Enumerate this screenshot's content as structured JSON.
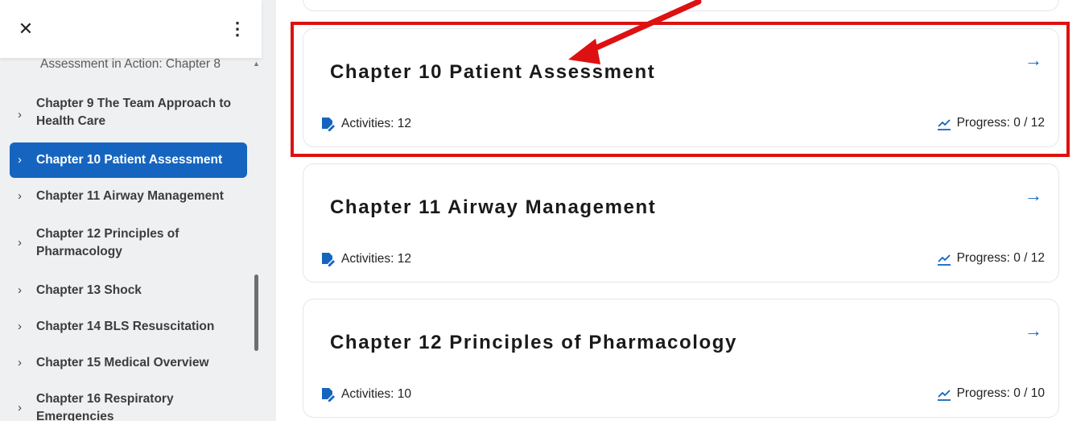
{
  "sidebar": {
    "close_icon": "close-icon",
    "more_icon": "more-vertical-icon",
    "close_glyph": "✕",
    "more_glyph": "⋮",
    "subitem": "Assessment in Action: Chapter 8",
    "items": [
      {
        "label_lines": [
          "Chapter 9 The Team Approach to",
          "Health Care"
        ],
        "active": false
      },
      {
        "label_lines": [
          "Chapter 10 Patient Assessment"
        ],
        "active": true
      },
      {
        "label_lines": [
          "Chapter 11 Airway Management"
        ],
        "active": false
      },
      {
        "label_lines": [
          "Chapter 12 Principles of",
          "Pharmacology"
        ],
        "active": false
      },
      {
        "label_lines": [
          "Chapter 13 Shock"
        ],
        "active": false
      },
      {
        "label_lines": [
          "Chapter 14 BLS Resuscitation"
        ],
        "active": false
      },
      {
        "label_lines": [
          "Chapter 15 Medical Overview"
        ],
        "active": false
      },
      {
        "label_lines": [
          "Chapter 16 Respiratory",
          "Emergencies"
        ],
        "active": false
      }
    ]
  },
  "cards": [
    {
      "title": "Chapter 10 Patient Assessment",
      "activities": "Activities: 12",
      "progress": "Progress: 0 / 12",
      "highlighted": true
    },
    {
      "title": "Chapter 11 Airway Management",
      "activities": "Activities: 12",
      "progress": "Progress: 0 / 12",
      "highlighted": false
    },
    {
      "title": "Chapter 12 Principles of Pharmacology",
      "activities": "Activities: 10",
      "progress": "Progress: 0 / 10",
      "highlighted": false
    }
  ],
  "colors": {
    "accent": "#1565c0",
    "highlight": "#dd1111",
    "sidebar_bg": "#eef0f2"
  },
  "icons": {
    "activities": "edit-document-icon",
    "progress": "trending-up-icon",
    "open": "arrow-right-icon",
    "arrow_glyph": "→"
  }
}
